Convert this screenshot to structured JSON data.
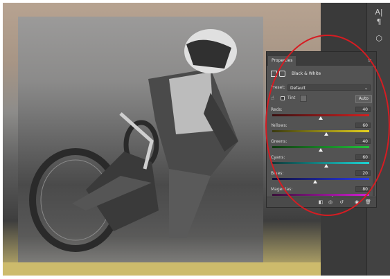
{
  "panel": {
    "tab_label": "Properties",
    "adjustment_title": "Black & White",
    "preset_label": "Preset:",
    "preset_value": "Default",
    "tint_label": "Tint",
    "auto_label": "Auto",
    "sliders": [
      {
        "label": "Reds:",
        "value": "40",
        "level": 0.5,
        "gradient": "linear-gradient(90deg,#3a1010,#d32020)"
      },
      {
        "label": "Yellows:",
        "value": "60",
        "level": 0.56,
        "gradient": "linear-gradient(90deg,#3a3a10,#e6d21e)"
      },
      {
        "label": "Greens:",
        "value": "40",
        "level": 0.5,
        "gradient": "linear-gradient(90deg,#103a10,#21c23a)"
      },
      {
        "label": "Cyans:",
        "value": "60",
        "level": 0.56,
        "gradient": "linear-gradient(90deg,#103a3a,#1ed2d2)"
      },
      {
        "label": "Blues:",
        "value": "20",
        "level": 0.44,
        "gradient": "linear-gradient(90deg,#10103a,#2a3ae6)"
      },
      {
        "label": "Magentas:",
        "value": "80",
        "level": 0.62,
        "gradient": "linear-gradient(90deg,#3a103a,#d21ed2)"
      }
    ]
  },
  "icons": {
    "character": "A|",
    "paragraph": "¶",
    "cube": "⬡"
  },
  "colors": {
    "highlight_circle": "#d61c22",
    "panel_bg": "#535353"
  }
}
